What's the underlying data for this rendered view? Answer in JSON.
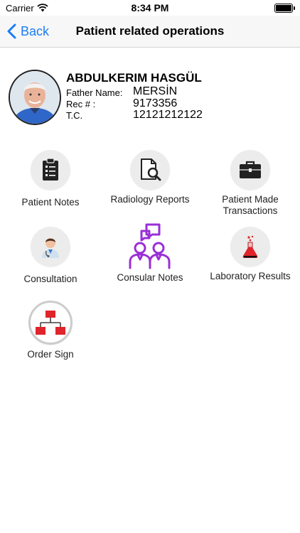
{
  "status": {
    "carrier": "Carrier",
    "time": "8:34 PM"
  },
  "nav": {
    "back_label": "Back",
    "title": "Patient related operations"
  },
  "patient": {
    "name": "ABDULKERIM HASGÜL",
    "father_label": "Father Name:",
    "father_value": "MERSİN",
    "rec_label": "Rec # :",
    "rec_value": "9173356",
    "tc_label": "T.C.",
    "tc_value": "12121212122"
  },
  "tiles": [
    {
      "label": "Patient Notes",
      "icon": "clipboard-icon"
    },
    {
      "label": "Radiology Reports",
      "icon": "radiology-report-icon"
    },
    {
      "label": "Patient Made Transactions",
      "icon": "briefcase-icon"
    },
    {
      "label": "Consultation",
      "icon": "doctor-icon"
    },
    {
      "label": "Consular Notes",
      "icon": "consular-chat-icon"
    },
    {
      "label": "Laboratory Results",
      "icon": "flask-icon"
    },
    {
      "label": "Order Sign",
      "icon": "org-chart-icon"
    }
  ],
  "colors": {
    "accent": "#1a7cf5",
    "consular_purple": "#9a2fd6",
    "order_sign_red": "#e0242b"
  }
}
